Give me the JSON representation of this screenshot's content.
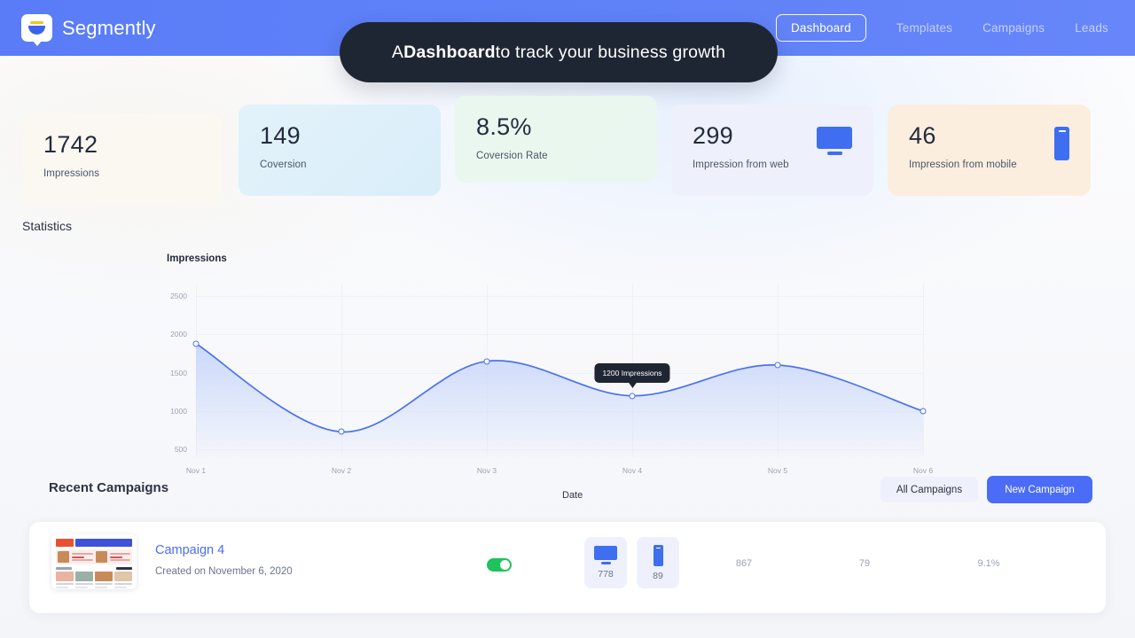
{
  "navbar": {
    "brand": "Segmently",
    "logo_icon": "segmently-funnel-icon",
    "links": [
      {
        "label": "Dashboard",
        "active": true
      },
      {
        "label": "Templates",
        "active": false
      },
      {
        "label": "Campaigns",
        "active": false
      },
      {
        "label": "Leads",
        "active": false
      }
    ]
  },
  "hero": {
    "prefix": "A ",
    "emphasis": "Dashboard",
    "suffix": " to track your business growth"
  },
  "stats": [
    {
      "value": "1742",
      "label": "Impressions",
      "icon": null
    },
    {
      "value": "149",
      "label": "Coversion",
      "icon": null
    },
    {
      "value": "8.5%",
      "label": "Coversion Rate",
      "icon": null
    },
    {
      "value": "299",
      "label": "Impression from web",
      "icon": "monitor-icon"
    },
    {
      "value": "46",
      "label": "Impression from mobile",
      "icon": "phone-icon"
    }
  ],
  "statistics": {
    "section_title": "Statistics"
  },
  "chart_data": {
    "type": "area",
    "title": "Impressions",
    "xlabel": "Date",
    "ylabel": "Impressions",
    "categories": [
      "Nov 1",
      "Nov 2",
      "Nov 3",
      "Nov 4",
      "Nov 5",
      "Nov 6"
    ],
    "values": [
      1880,
      730,
      1650,
      1200,
      1600,
      1000
    ],
    "yticks": [
      "2500",
      "2000",
      "1500",
      "1000",
      "500"
    ],
    "ylim": [
      400,
      2650
    ],
    "grid": true,
    "legend": "none",
    "line_color": "#4a72ef",
    "fill_color": "#c8d6fb",
    "tooltip": {
      "text": "1200 Impressions",
      "at_category": "Nov 4"
    }
  },
  "recent_campaigns": {
    "title": "Recent Campaigns",
    "all_button": "All Campaigns",
    "new_button": "New Campaign",
    "rows": [
      {
        "thumbnail_icon": "email-template-thumbnail",
        "name": "Campaign 4",
        "created": "Created on November 6, 2020",
        "enabled": true,
        "web_icon": "monitor-icon",
        "web_count": "778",
        "mobile_icon": "phone-icon",
        "mobile_count": "89",
        "metric_1": "867",
        "metric_2": "79",
        "metric_3": "9.1%"
      }
    ]
  },
  "colors": {
    "brand_blue": "#4a6cf7",
    "nav_blue": "#5f81f8",
    "dark": "#1f2633",
    "toggle_green": "#1ec35b"
  }
}
